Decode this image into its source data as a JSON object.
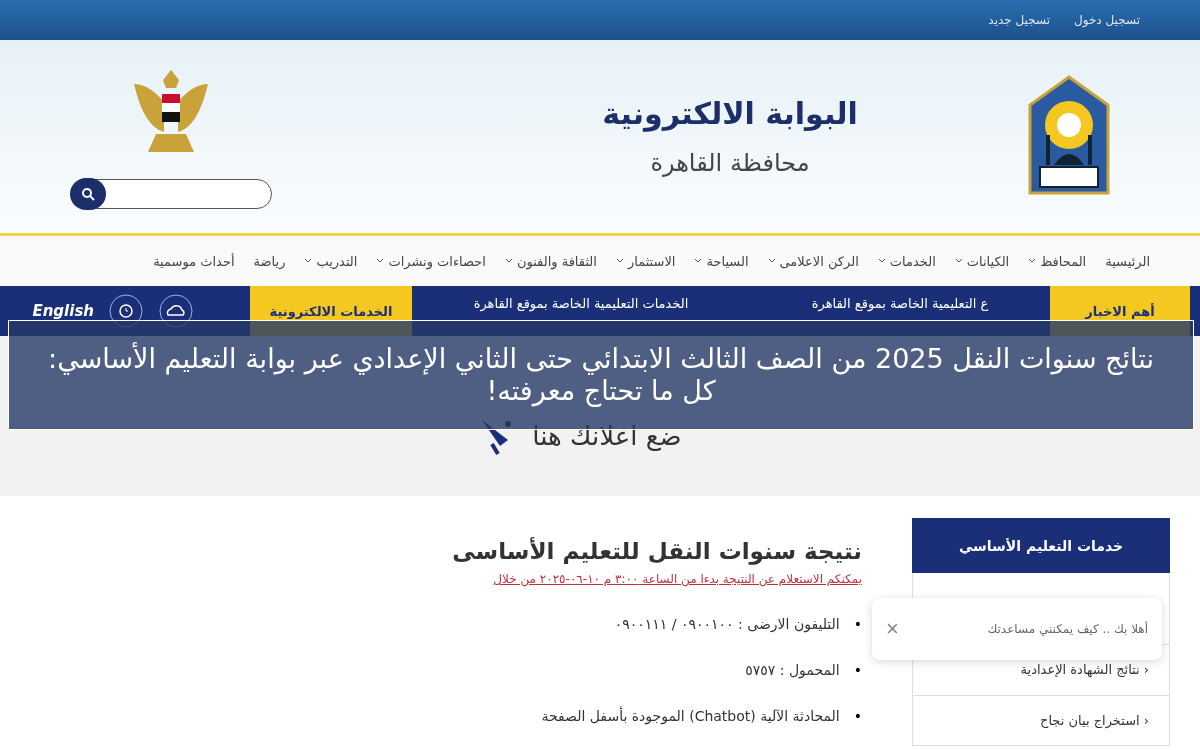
{
  "top_links": [
    "تسجيل دخول",
    "تسجيل جديد"
  ],
  "header": {
    "title": "البوابة الالكترونية",
    "subtitle": "محافظة القاهرة"
  },
  "nav": [
    {
      "label": "الرئيسية",
      "dropdown": false
    },
    {
      "label": "المحافظ",
      "dropdown": true
    },
    {
      "label": "الكيانات",
      "dropdown": true
    },
    {
      "label": "الخدمات",
      "dropdown": true
    },
    {
      "label": "الركن الاعلامى",
      "dropdown": true
    },
    {
      "label": "السياحة",
      "dropdown": true
    },
    {
      "label": "الاستثمار",
      "dropdown": true
    },
    {
      "label": "الثقافة والفنون",
      "dropdown": true
    },
    {
      "label": "احصاءات ونشرات",
      "dropdown": true
    },
    {
      "label": "التدريب",
      "dropdown": true
    },
    {
      "label": "رياضة",
      "dropdown": false
    },
    {
      "label": "أحداث موسمية",
      "dropdown": false
    }
  ],
  "news_bar": {
    "label": "أهم الاخبار",
    "ticker": [
      "ع التعليمية الخاصة بموقع القاهرة",
      "الخدمات التعليمية الخاصة بموقع القاهرة"
    ],
    "services_button": "الخدمات الالكترونية",
    "language": "English"
  },
  "headline": "نتائج سنوات النقل 2025 من الصف الثالث الابتدائي حتى الثاني الإعدادي عبر بوابة التعليم الأساسي: كل ما تحتاج معرفته!",
  "ad": "ضع اعلانك هنا",
  "article": {
    "title": "نتيجة سنوات النقل للتعليم الأساسى",
    "link": "يمكنكم الاستعلام عن النتيجة بدءا من الساعة ٣:٠٠ م ١٠-٠٦-٢٠٢٥ من خلال",
    "bullets": [
      {
        "marker": "•",
        "text": "التليفون الارضى : ٠٩٠٠١٠٠ / ٠٩٠٠١١١"
      },
      {
        "marker": "•",
        "text": "المحمول : ٥٧٥٧"
      },
      {
        "marker": "•",
        "text": "المحادثة الآلية (Chatbot) الموجودة بأسفل الصفحة"
      }
    ]
  },
  "sidebar": {
    "title": "خدمات التعليم الأساسي",
    "items": [
      {
        "arrow": "‹",
        "label": "نتائج الشهادة الإعدادية"
      },
      {
        "arrow": "‹",
        "label": "استخراج بيان نجاح"
      }
    ]
  },
  "chat_popup": {
    "message": "أهلا بك .. كيف يمكنني مساعدتك",
    "close": "×"
  }
}
